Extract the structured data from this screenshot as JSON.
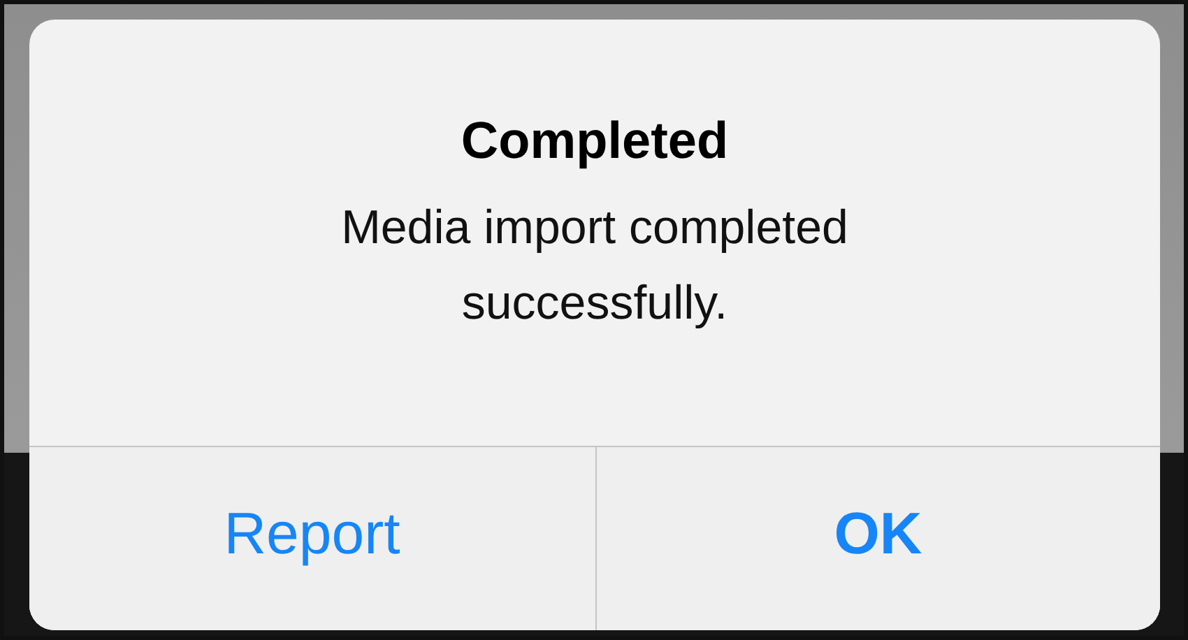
{
  "alert": {
    "title": "Completed",
    "message": "Media import completed successfully.",
    "buttons": [
      {
        "label": "Report",
        "primary": false
      },
      {
        "label": "OK",
        "primary": true
      }
    ]
  }
}
